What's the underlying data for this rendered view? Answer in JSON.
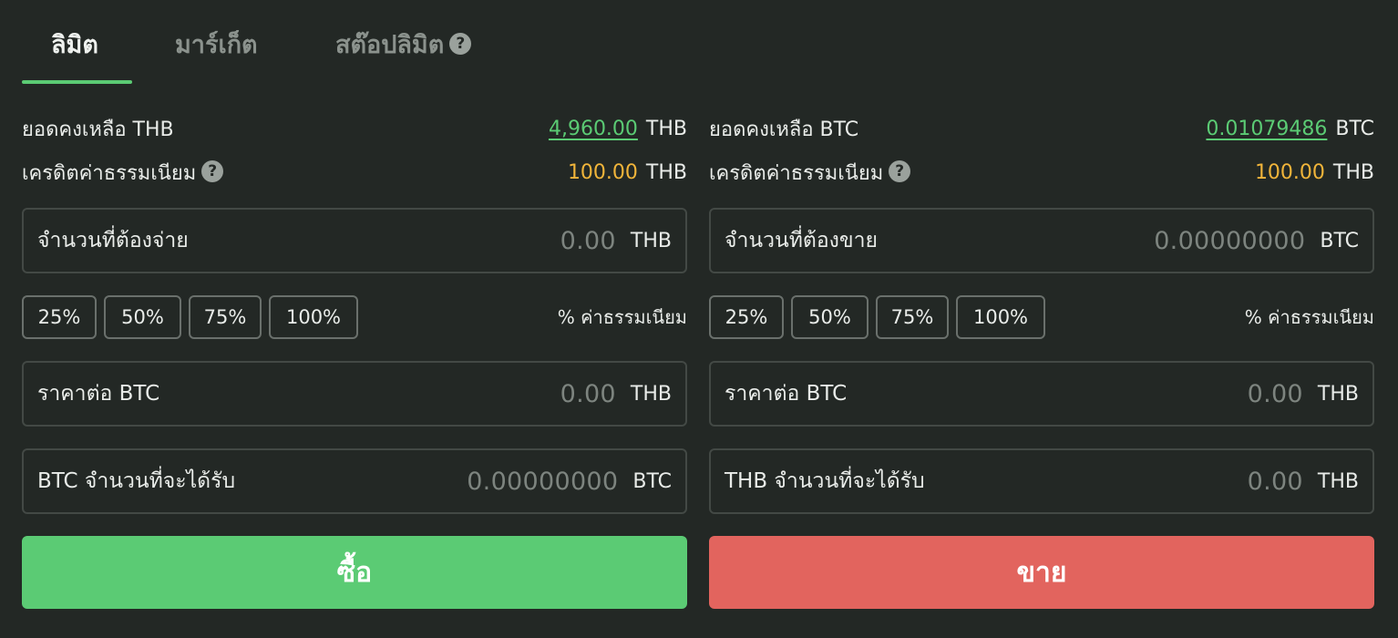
{
  "tabs": [
    {
      "label": "ลิมิต",
      "active": true
    },
    {
      "label": "มาร์เก็ต",
      "active": false
    },
    {
      "label": "สต๊อปลิมิต",
      "active": false
    }
  ],
  "help_glyph": "?",
  "buy": {
    "balance_label": "ยอดคงเหลือ THB",
    "balance_value": "4,960.00",
    "balance_unit": "THB",
    "fee_credit_label": "เครดิตค่าธรรมเนียม",
    "fee_credit_value": "100.00",
    "fee_credit_unit": "THB",
    "amount": {
      "label": "จำนวนที่ต้องจ่าย",
      "value": "0.00",
      "unit": "THB"
    },
    "percent_buttons": [
      "25%",
      "50%",
      "75%",
      "100%"
    ],
    "fee_percent_label": "% ค่าธรรมเนียม",
    "price": {
      "label": "ราคาต่อ BTC",
      "value": "0.00",
      "unit": "THB"
    },
    "receive": {
      "label": "BTC จำนวนที่จะได้รับ",
      "value": "0.00000000",
      "unit": "BTC"
    },
    "action_label": "ซื้อ"
  },
  "sell": {
    "balance_label": "ยอดคงเหลือ BTC",
    "balance_value": "0.01079486",
    "balance_unit": "BTC",
    "fee_credit_label": "เครดิตค่าธรรมเนียม",
    "fee_credit_value": "100.00",
    "fee_credit_unit": "THB",
    "amount": {
      "label": "จำนวนที่ต้องขาย",
      "value": "0.00000000",
      "unit": "BTC"
    },
    "percent_buttons": [
      "25%",
      "50%",
      "75%",
      "100%"
    ],
    "fee_percent_label": "% ค่าธรรมเนียม",
    "price": {
      "label": "ราคาต่อ BTC",
      "value": "0.00",
      "unit": "THB"
    },
    "receive": {
      "label": "THB จำนวนที่จะได้รับ",
      "value": "0.00",
      "unit": "THB"
    },
    "action_label": "ขาย"
  },
  "colors": {
    "background": "#232825",
    "accent_green": "#5bcb74",
    "sell_red": "#e2645e",
    "fee_orange": "#f0b43a"
  }
}
